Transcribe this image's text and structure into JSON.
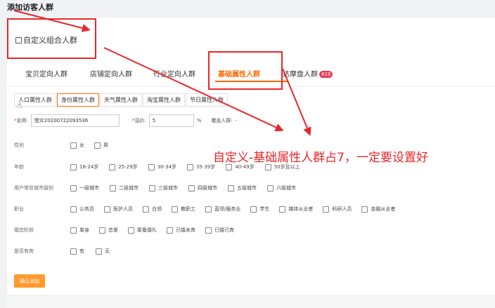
{
  "page": {
    "title": "添加访客人群"
  },
  "section": {
    "custom_title": "自定义组合人群"
  },
  "tabs": [
    {
      "label": "宝贝定向人群"
    },
    {
      "label": "店铺定向人群"
    },
    {
      "label": "行业定向人群"
    },
    {
      "label": "基础属性人群"
    },
    {
      "label": "达摩盘人群",
      "badge": "618"
    }
  ],
  "subtabs": [
    "人口属性人群",
    "身份属性人群",
    "天气属性人群",
    "淘宝属性人群",
    "节日属性人群"
  ],
  "form": {
    "name_label": "名称:",
    "name_value": "受众20200722093536",
    "premium_label": "溢价:",
    "premium_value": "5",
    "premium_unit": "%",
    "coverage_label": "覆盖人群:",
    "coverage_value": "-"
  },
  "rows": [
    {
      "label": "性别",
      "options": [
        "女",
        "男"
      ]
    },
    {
      "label": "年龄",
      "options": [
        "18-24岁",
        "25-29岁",
        "30-34岁",
        "35-39岁",
        "40-49岁",
        "50岁及以上"
      ]
    },
    {
      "label": "用户常驻城市级别",
      "options": [
        "一级城市",
        "二级城市",
        "三级城市",
        "四级城市",
        "五级城市",
        "六级城市"
      ]
    },
    {
      "label": "职业",
      "options": [
        "公务员",
        "医护人员",
        "白领",
        "教职工",
        "蓝领/服务业",
        "学生",
        "媒体从业者",
        "科研人员",
        "金融从业者"
      ]
    },
    {
      "label": "婚恋阶段",
      "options": [
        "单身",
        "恋爱",
        "筹备婚礼",
        "已婚未育",
        "已婚已育"
      ]
    },
    {
      "label": "是否有房",
      "options": [
        "有",
        "无"
      ]
    }
  ],
  "confirm_label": "确认添加",
  "annotation": "自定义-基础属性人群占7，一定要设置好",
  "colors": {
    "accent": "#ff6a00",
    "annotation_red": "#e8272a",
    "button": "#ff9a2e"
  }
}
